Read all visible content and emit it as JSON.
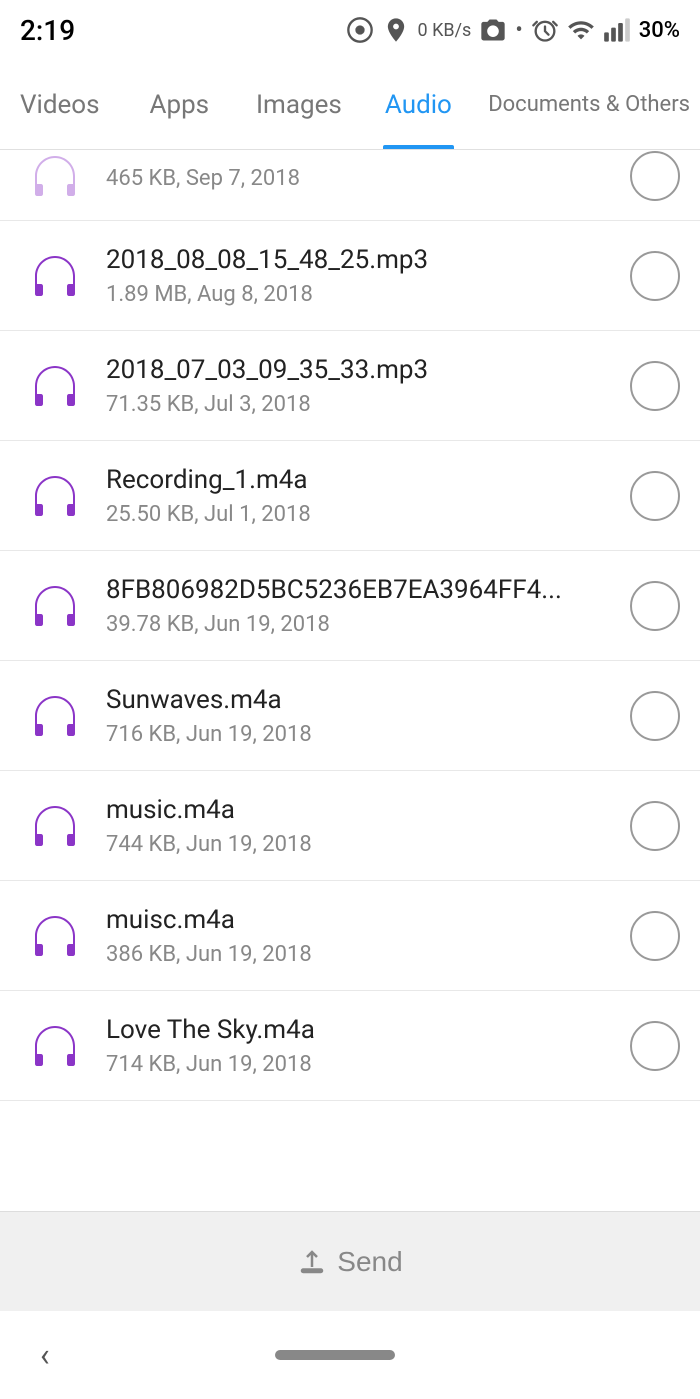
{
  "statusBar": {
    "time": "2:19",
    "batteryPercent": "30%"
  },
  "tabs": [
    {
      "id": "videos",
      "label": "Videos",
      "active": false
    },
    {
      "id": "apps",
      "label": "Apps",
      "active": false
    },
    {
      "id": "images",
      "label": "Images",
      "active": false
    },
    {
      "id": "audio",
      "label": "Audio",
      "active": true
    },
    {
      "id": "documents",
      "label": "Documents & Others",
      "active": false
    }
  ],
  "partialItem": {
    "meta": "465 KB, Sep 7, 2018"
  },
  "files": [
    {
      "name": "2018_08_08_15_48_25.mp3",
      "meta": "1.89 MB, Aug 8, 2018"
    },
    {
      "name": "2018_07_03_09_35_33.mp3",
      "meta": "71.35 KB, Jul 3, 2018"
    },
    {
      "name": "Recording_1.m4a",
      "meta": "25.50 KB, Jul 1, 2018"
    },
    {
      "name": "8FB806982D5BC5236EB7EA3964FF4...",
      "meta": "39.78 KB, Jun 19, 2018"
    },
    {
      "name": "Sunwaves.m4a",
      "meta": "716 KB, Jun 19, 2018"
    },
    {
      "name": "music.m4a",
      "meta": "744 KB, Jun 19, 2018"
    },
    {
      "name": "muisc.m4a",
      "meta": "386 KB, Jun 19, 2018"
    },
    {
      "name": "Love The Sky.m4a",
      "meta": "714 KB, Jun 19, 2018"
    }
  ],
  "sendButton": {
    "label": "Send"
  },
  "colors": {
    "purple": "#8B35C7",
    "activeTab": "#2196F3"
  }
}
